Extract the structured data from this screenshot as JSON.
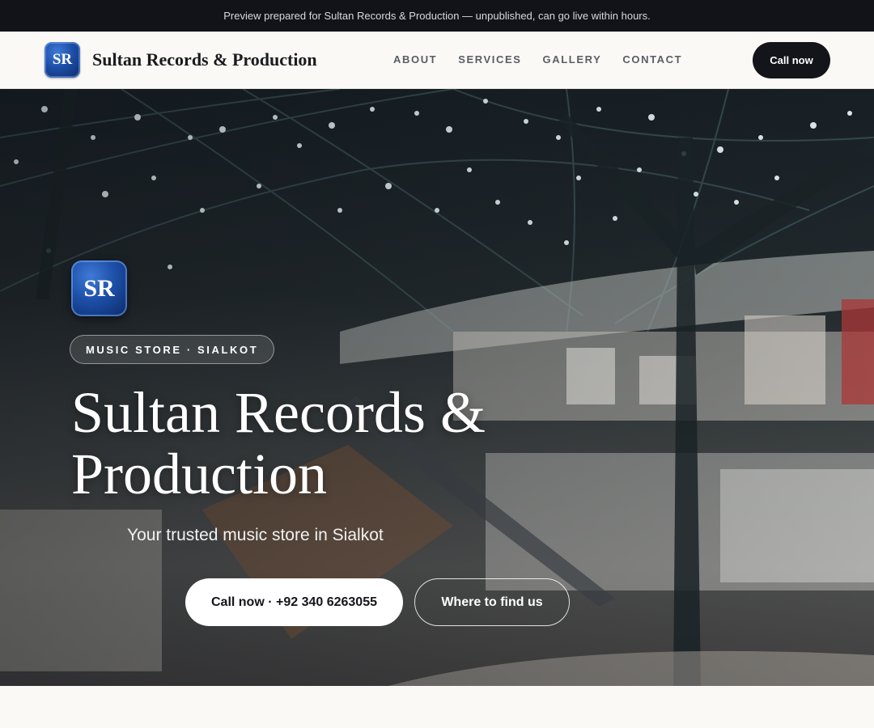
{
  "preview_banner": {
    "text": "Preview prepared for Sultan Records & Production — unpublished, can go live within hours."
  },
  "header": {
    "logo_initials": "SR",
    "brand_name": "Sultan Records & Production",
    "nav": [
      {
        "label": "ABOUT"
      },
      {
        "label": "SERVICES"
      },
      {
        "label": "GALLERY"
      },
      {
        "label": "CONTACT"
      }
    ],
    "cta_label": "Call now"
  },
  "hero": {
    "logo_initials": "SR",
    "tagline_pill": "MUSIC STORE · SIALKOT",
    "title_line1": "Sultan Records &",
    "title_line2": "Production",
    "subtitle": "Your trusted music store in Sialkot",
    "primary_cta": "Call now · +92 340 6263055",
    "secondary_cta": "Where to find us",
    "background_image": "shopping-mall-interior-photo"
  },
  "colors": {
    "banner_bg": "#111318",
    "page_bg": "#faf9f6",
    "dark_button": "#14151a",
    "logo_blue": "#1d4fa8",
    "nav_text": "#5a5d66"
  }
}
